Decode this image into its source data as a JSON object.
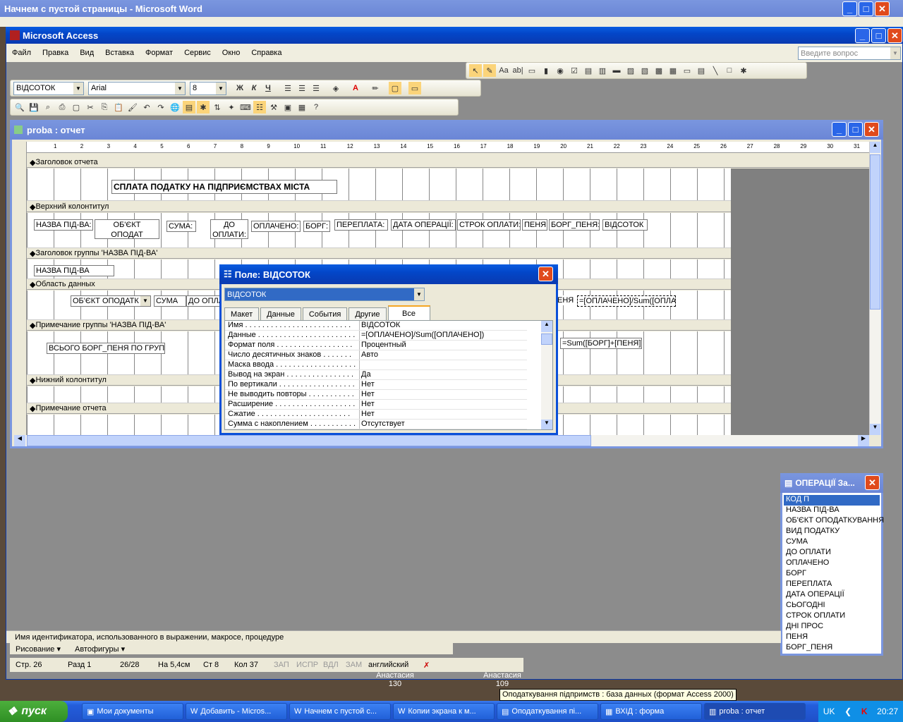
{
  "word_window": {
    "title": "Начнем с пустой страницы - Microsoft Word"
  },
  "access_window": {
    "title": "Microsoft Access"
  },
  "menu": [
    "Файл",
    "Правка",
    "Вид",
    "Вставка",
    "Формат",
    "Сервис",
    "Окно",
    "Справка"
  ],
  "help_box": {
    "placeholder": "Введите вопрос"
  },
  "format_toolbar": {
    "object": "ВІДСОТОК",
    "font": "Arial",
    "size": "8",
    "bold": "Ж",
    "italic": "К",
    "underline": "Ч"
  },
  "report_window": {
    "title": "proba : отчет"
  },
  "ruler": [
    "1",
    "2",
    "3",
    "4",
    "5",
    "6",
    "7",
    "8",
    "9",
    "10",
    "11",
    "12",
    "13",
    "14",
    "15",
    "16",
    "17",
    "18",
    "19",
    "20",
    "21",
    "22",
    "23",
    "24",
    "25",
    "26",
    "27",
    "28",
    "29",
    "30",
    "31"
  ],
  "sections": {
    "report_header": "Заголовок отчета",
    "page_header": "Верхний колонтитул",
    "group_header": "Заголовок группы 'НАЗВА ПІД-ВА'",
    "detail": "Область данных",
    "group_footer": "Примечание группы 'НАЗВА ПІД-ВА'",
    "page_footer": "Нижний колонтитул",
    "report_footer": "Примечание отчета"
  },
  "report_title": "СПЛАТА ПОДАТКУ НА ПІДПРИЄМСТВАХ МІСТА",
  "header_labels": [
    "НАЗВА ПІД-ВА:",
    "ОБ'ЄКТ ОПОДАТ КУВАННЯ:",
    "СУМА:",
    "ДО ОПЛАТИ:",
    "ОПЛАЧЕНО:",
    "БОРГ:",
    "ПЕРЕПЛАТА:",
    "ДАТА ОПЕРАЦІЇ:",
    "СТРОК ОПЛАТИ:",
    "ПЕНЯ:",
    "БОРГ_ПЕНЯ:",
    "ВІДСОТОК"
  ],
  "group_field": "НАЗВА ПІД-ВА",
  "detail_fields": {
    "object": "ОБ'ЄКТ ОПОДАТК",
    "suma": "СУМА",
    "do_oplaty": "ДО ОПЛА",
    "penia": "ЕНЯ",
    "percent": "=[ОПЛАЧЕНО]/Sum([ОПЛА"
  },
  "footer_fields": {
    "label": "ВСЬОГО БОРГ_ПЕНЯ ПО ГРУПІ:",
    "sum": "=Sum([БОРГ]+[ПЕНЯ])"
  },
  "property_dialog": {
    "title": "Поле: ВІДСОТОК",
    "selector": "ВІДСОТОК",
    "tabs": [
      "Макет",
      "Данные",
      "События",
      "Другие",
      "Все"
    ],
    "active_tab": "Все",
    "rows": [
      {
        "k": "Имя . . . . . . . . . . . . . . . . . . . . . . . . .",
        "v": "ВІДСОТОК"
      },
      {
        "k": "Данные . . . . . . . . . . . . . . . . . . . . . . .",
        "v": "=[ОПЛАЧЕНО]/Sum([ОПЛАЧЕНО])"
      },
      {
        "k": "Формат поля . . . . . . . . . . . . . . . . . .",
        "v": "Процентный"
      },
      {
        "k": "Число десятичных знаков . . . . . . .",
        "v": "Авто"
      },
      {
        "k": "Маска ввода . . . . . . . . . . . . . . . . . . .",
        "v": ""
      },
      {
        "k": "Вывод на экран . . . . . . . . . . . . . . . .",
        "v": "Да"
      },
      {
        "k": "По вертикали . . . . . . . . . . . . . . . . . .",
        "v": "Нет"
      },
      {
        "k": "Не выводить повторы . . . . . . . . . . .",
        "v": "Нет"
      },
      {
        "k": "Расширение . . . . . . . . . . . . . . . . . . .",
        "v": "Нет"
      },
      {
        "k": "Сжатие . . . . . . . . . . . . . . . . . . . . . .",
        "v": "Нет"
      },
      {
        "k": "Сумма с накоплением . . . . . . . . . . .",
        "v": "Отсутствует"
      }
    ]
  },
  "field_list": {
    "title": "ОПЕРАЦІЇ За...",
    "items": [
      "КОД П",
      "НАЗВА ПІД-ВА",
      "ОБ'ЄКТ ОПОДАТКУВАННЯ",
      "ВИД ПОДАТКУ",
      "СУМА",
      "ДО ОПЛАТИ",
      "ОПЛАЧЕНО",
      "БОРГ",
      "ПЕРЕПЛАТА",
      "ДАТА ОПЕРАЦІЇ",
      "СЬОГОДНІ",
      "СТРОК ОПЛАТИ",
      "ДНІ ПРОС",
      "ПЕНЯ",
      "БОРГ_ПЕНЯ"
    ]
  },
  "status_hint": "Имя идентификатора, использованного в выражении, макросе, процедуре",
  "drawing_bar": {
    "draw": "Рисование ▾",
    "autoshapes": "Автофигуры ▾"
  },
  "word_status": {
    "page": "Стр. 26",
    "section": "Разд 1",
    "pages": "26/28",
    "at": "На 5,4см",
    "line": "Ст 8",
    "col": "Кол 37",
    "rec": "ЗАП",
    "trk": "ИСПР",
    "ext": "ВДЛ",
    "ovr": "ЗАМ",
    "lang": "английский"
  },
  "desktop_icons": [
    {
      "line1": "Анастасия",
      "line2": "130"
    },
    {
      "line1": "Анастасия",
      "line2": "109"
    }
  ],
  "tooltip": "Оподаткування підпримств : база данных (формат Access 2000)",
  "taskbar": {
    "start": "пуск",
    "items": [
      "Мои документы",
      "Добавить - Micros...",
      "Начнем с пустой с...",
      "Копии экрана к м...",
      "Оподаткування пі...",
      "ВХІД : форма",
      "proba : отчет"
    ],
    "lang": "UK",
    "time": "20:27"
  }
}
